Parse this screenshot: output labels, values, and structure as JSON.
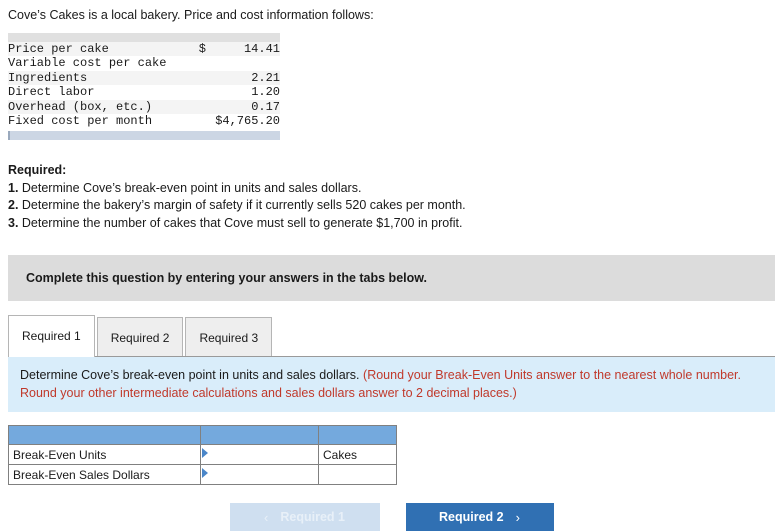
{
  "intro": "Cove’s Cakes is a local bakery. Price and cost information follows:",
  "cost_table": {
    "rows": [
      {
        "label": "Price per cake",
        "indent": 1,
        "currency": "$",
        "value": "14.41"
      },
      {
        "label": "Variable cost per cake",
        "indent": 1,
        "currency": "",
        "value": ""
      },
      {
        "label": "Ingredients",
        "indent": 2,
        "currency": "",
        "value": "2.21"
      },
      {
        "label": "Direct labor",
        "indent": 2,
        "currency": "",
        "value": "1.20"
      },
      {
        "label": "Overhead (box, etc.)",
        "indent": 2,
        "currency": "",
        "value": "0.17"
      },
      {
        "label": "Fixed cost per month",
        "indent": 1,
        "currency": "",
        "value": "$4,765.20"
      }
    ]
  },
  "required": {
    "heading": "Required:",
    "items": [
      {
        "num": "1.",
        "text": "Determine Cove’s break-even point in units and sales dollars."
      },
      {
        "num": "2.",
        "text": "Determine the bakery’s margin of safety if it currently sells 520 cakes per month."
      },
      {
        "num": "3.",
        "text": "Determine the number of cakes that Cove must sell to generate $1,700 in profit."
      }
    ]
  },
  "banner": {
    "text": "Complete this question by entering your answers in the tabs below."
  },
  "tabs": [
    {
      "label": "Required 1",
      "active": true
    },
    {
      "label": "Required 2",
      "active": false
    },
    {
      "label": "Required 3",
      "active": false
    }
  ],
  "panel": {
    "black_text": "Determine Cove’s break-even point in units and sales dollars.",
    "red_text": "(Round your Break-Even Units answer to the nearest whole number. Round your other intermediate calculations and sales dollars answer to 2 decimal places.)"
  },
  "answer_table": {
    "header": [
      "",
      "",
      ""
    ],
    "rows": [
      {
        "label": "Break-Even Units",
        "value": "",
        "unit": "Cakes"
      },
      {
        "label": "Break-Even Sales Dollars",
        "value": "",
        "unit": ""
      }
    ]
  },
  "nav": {
    "prev_label": "Required 1",
    "prev_icon": "chevron-left-icon",
    "prev_chevron": "‹",
    "next_label": "Required 2",
    "next_icon": "chevron-right-icon",
    "next_chevron": "›"
  },
  "colors": {
    "accent_blue": "#3070b3",
    "table_header_blue": "#74a9dd",
    "panel_blue": "#d9edfa",
    "banner_gray": "#dcdcdc",
    "red_text": "#c0392b"
  }
}
